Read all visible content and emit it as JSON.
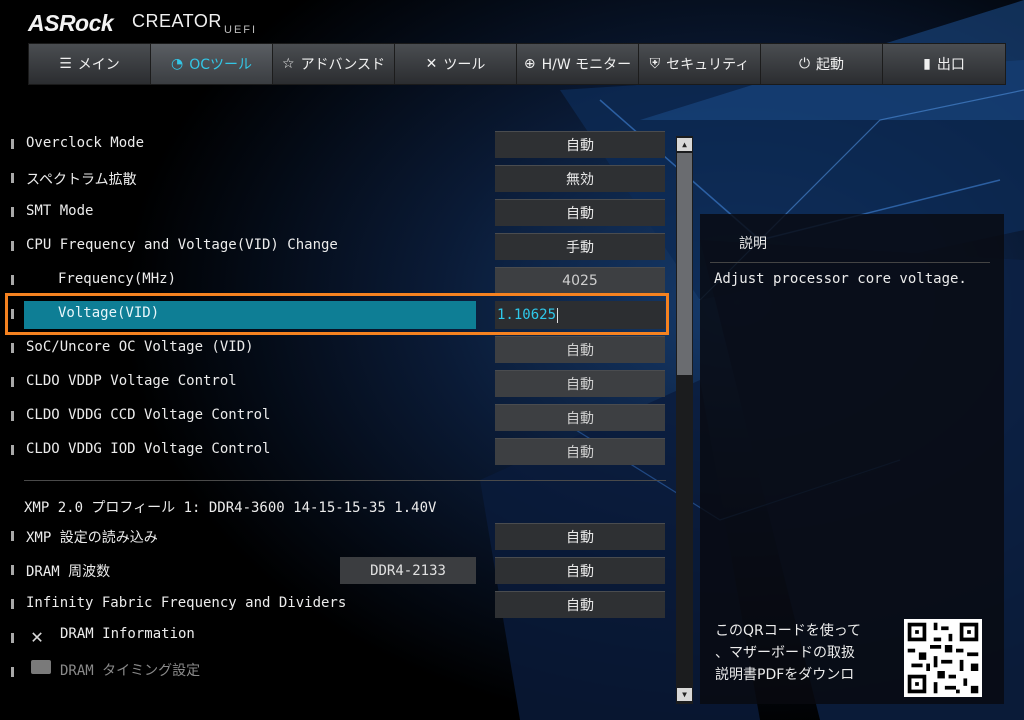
{
  "brand": {
    "name": "ASRock",
    "product": "CREATOR",
    "suffix": "UEFI"
  },
  "nav": {
    "tabs": [
      {
        "label": "メイン",
        "icon": "list-icon"
      },
      {
        "label": "OCツール",
        "icon": "speedometer-icon",
        "active": true
      },
      {
        "label": "アドバンスド",
        "icon": "star-icon"
      },
      {
        "label": "ツール",
        "icon": "tools-icon"
      },
      {
        "label": "H/W モニター",
        "icon": "monitor-icon"
      },
      {
        "label": "セキュリティ",
        "icon": "shield-icon"
      },
      {
        "label": "起動",
        "icon": "power-icon"
      },
      {
        "label": "出口",
        "icon": "exit-door-icon"
      }
    ]
  },
  "settings": [
    {
      "label": "Overclock Mode",
      "value": "自動"
    },
    {
      "label": "スペクトラム拡散",
      "value": "無効"
    },
    {
      "label": "SMT Mode",
      "value": "自動"
    },
    {
      "label": "CPU Frequency and Voltage(VID) Change",
      "value": "手動"
    },
    {
      "label": "Frequency(MHz)",
      "value": "4025"
    },
    {
      "label": "Voltage(VID)",
      "value": "1.10625"
    },
    {
      "label": "SoC/Uncore OC Voltage (VID)",
      "value": "自動"
    },
    {
      "label": "CLDO VDDP Voltage Control",
      "value": "自動"
    },
    {
      "label": "CLDO VDDG CCD Voltage Control",
      "value": "自動"
    },
    {
      "label": "CLDO VDDG IOD Voltage Control",
      "value": "自動"
    }
  ],
  "xmp": {
    "profile": "XMP 2.0 プロフィール 1: DDR4-3600 14-15-15-35 1.40V",
    "load": {
      "label": "XMP 設定の読み込み",
      "value": "自動"
    },
    "dram_freq": {
      "label": "DRAM 周波数",
      "current": "DDR4-2133",
      "value": "自動"
    },
    "infinity": {
      "label": "Infinity Fabric Frequency and Dividers",
      "value": "自動"
    },
    "dram_info": "DRAM Information",
    "dram_timing": "DRAM タイミング設定"
  },
  "description": {
    "title": "説明",
    "text": "Adjust processor core voltage.",
    "qr_lines": [
      "このQRコードを使って",
      "、マザーボードの取扱",
      "説明書PDFをダウンロ"
    ]
  },
  "colors": {
    "accent": "#33c6e6",
    "selection": "#0e7e95",
    "highlight": "#f58220"
  }
}
